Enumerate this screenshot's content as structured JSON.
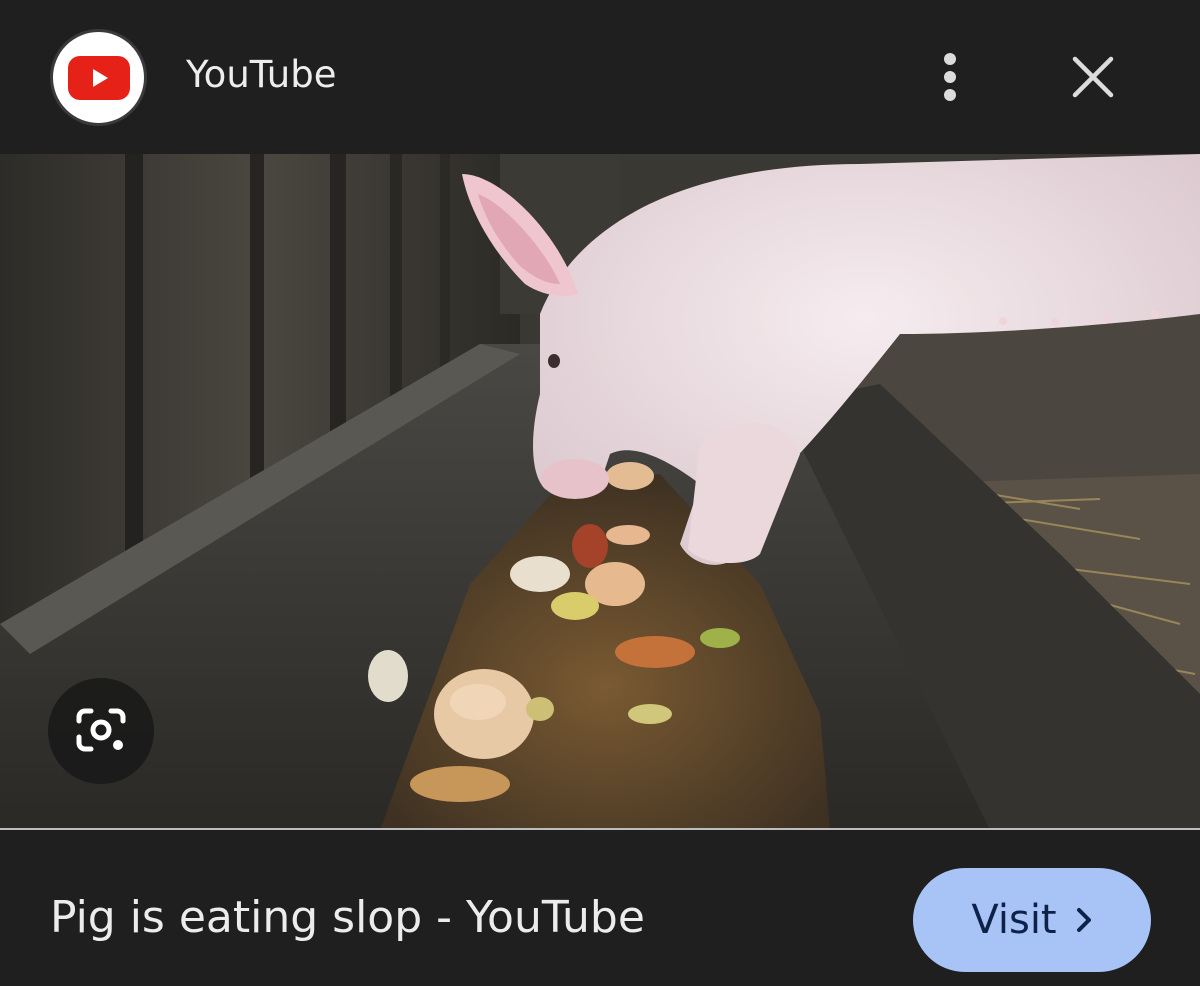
{
  "header": {
    "source_name": "YouTube",
    "logo_icon": "youtube-logo",
    "more_icon": "more-vertical-icon",
    "close_icon": "close-icon"
  },
  "image": {
    "subject": "pig eating slop",
    "lens_icon": "google-lens-icon"
  },
  "footer": {
    "caption": "Pig is eating slop - YouTube",
    "visit_label": "Visit",
    "visit_icon": "chevron-right-icon"
  },
  "colors": {
    "background": "#1f1f1f",
    "visit_button": "#a8c4f7",
    "youtube_red": "#e62117"
  }
}
